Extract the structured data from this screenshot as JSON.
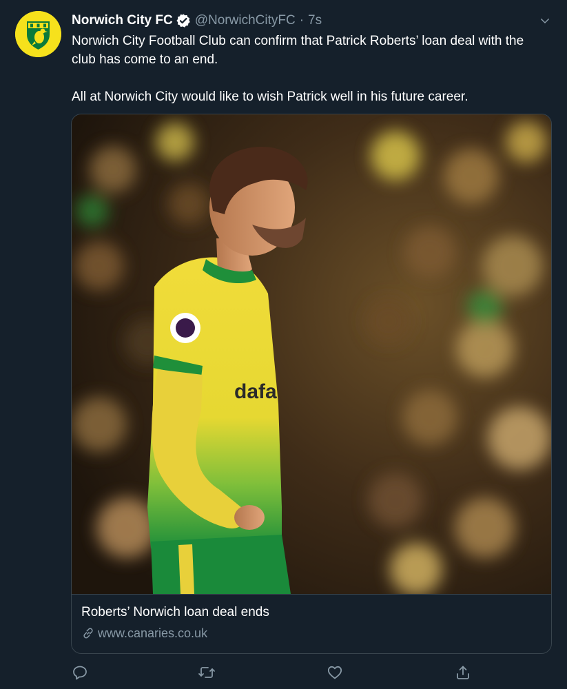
{
  "tweet": {
    "display_name": "Norwich City FC",
    "handle": "@NorwichCityFC",
    "separator": "·",
    "time": "7s",
    "text_paragraphs": [
      "Norwich City Football Club can confirm that Patrick Roberts’ loan deal with the club has come to an end.",
      "All at Norwich City would like to wish Patrick well in his future career."
    ]
  },
  "card": {
    "title": "Roberts’ Norwich loan deal ends",
    "url": "www.canaries.co.uk",
    "shirt_sponsor_partial": "dafa"
  },
  "icons": {
    "avatar": "norwich-crest-icon",
    "verified": "verified-badge-icon",
    "caret": "chevron-down-icon",
    "link": "link-icon",
    "reply": "reply-icon",
    "retweet": "retweet-icon",
    "like": "heart-icon",
    "share": "share-icon"
  },
  "colors": {
    "background": "#15202b",
    "border": "#38444d",
    "secondary_text": "#8899a6",
    "verified": "#ffffff",
    "crest_yellow": "#f6e11c",
    "crest_green": "#0a7a3a"
  }
}
